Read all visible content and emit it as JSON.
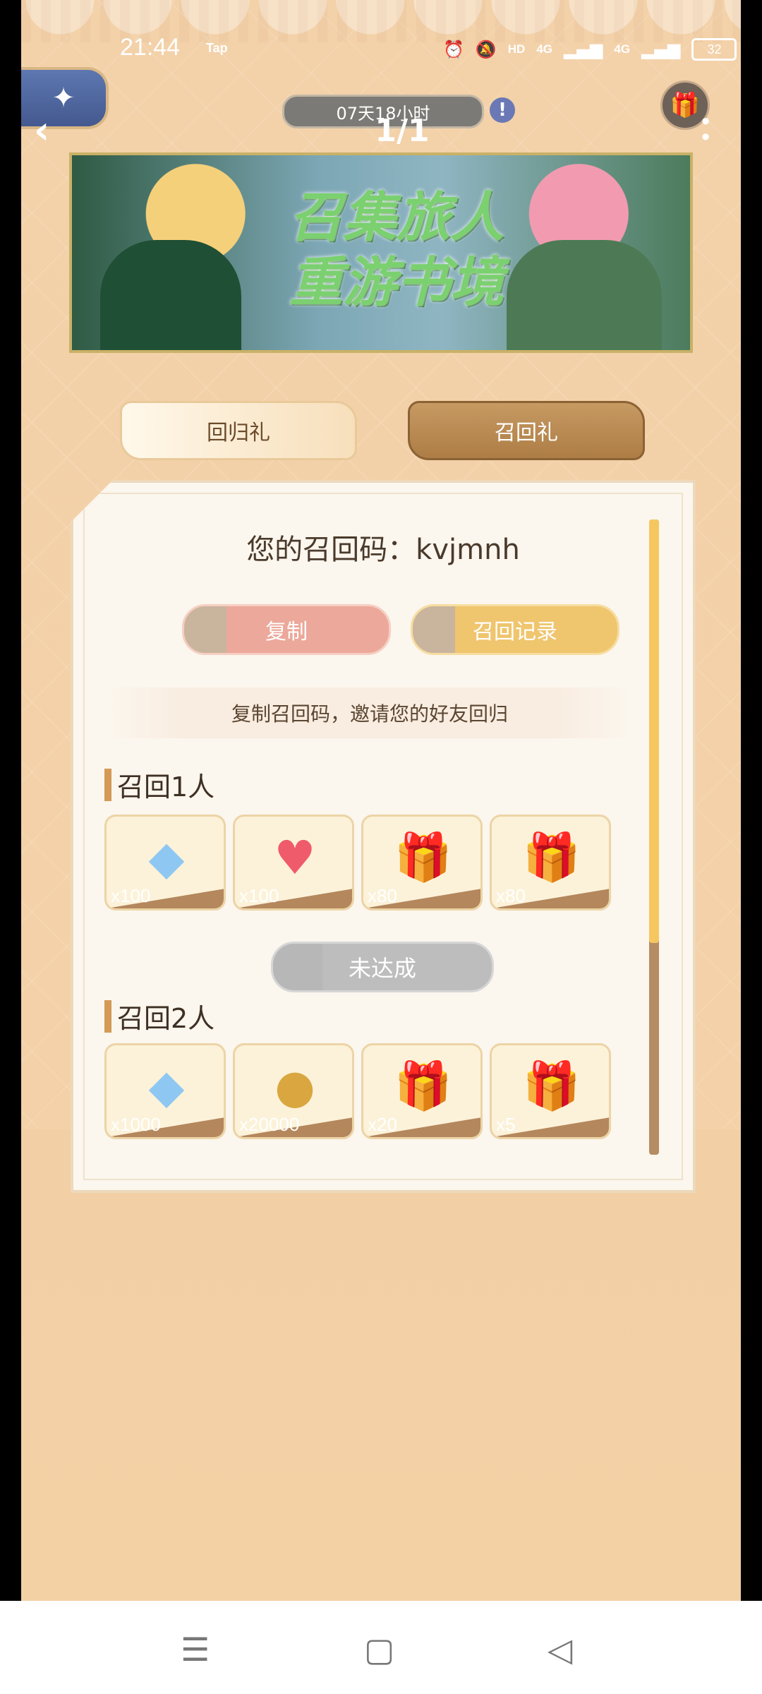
{
  "status_bar": {
    "time": "21:44",
    "app_tag": "Tap",
    "network_1": "4G",
    "network_2": "4G",
    "battery": "32"
  },
  "top_bar": {
    "timer": "07天18小时",
    "info_icon": "!",
    "pager": "1/1"
  },
  "banner": {
    "title_line1": "召集旅人",
    "title_line2": "重游书境"
  },
  "tabs": {
    "return_gift": "回归礼",
    "recall_gift": "召回礼",
    "active": "recall_gift"
  },
  "panel": {
    "recall_code_label": "您的召回码：kvjmnh",
    "copy_button": "复制",
    "record_button": "召回记录",
    "hint": "复制召回码，邀请您的好友回归",
    "sections": [
      {
        "title": "召回1人",
        "status": "未达成",
        "items": [
          {
            "icon": "diamond-icon",
            "qty": "x100"
          },
          {
            "icon": "heart-icon",
            "qty": "x100"
          },
          {
            "icon": "gift-box-icon",
            "qty": "x80"
          },
          {
            "icon": "gift-box-icon",
            "qty": "x80"
          }
        ]
      },
      {
        "title": "召回2人",
        "items": [
          {
            "icon": "diamond-icon",
            "qty": "x1000"
          },
          {
            "icon": "gold-coin-icon",
            "qty": "x20000"
          },
          {
            "icon": "gift-box-icon",
            "qty": "x20"
          },
          {
            "icon": "treasure-box-icon",
            "qty": "x5"
          }
        ]
      }
    ]
  },
  "colors": {
    "background": "#f3d1a9",
    "panel": "#fbf6ee",
    "accent_gold": "#f6c760",
    "tab_active": "#b88652"
  }
}
